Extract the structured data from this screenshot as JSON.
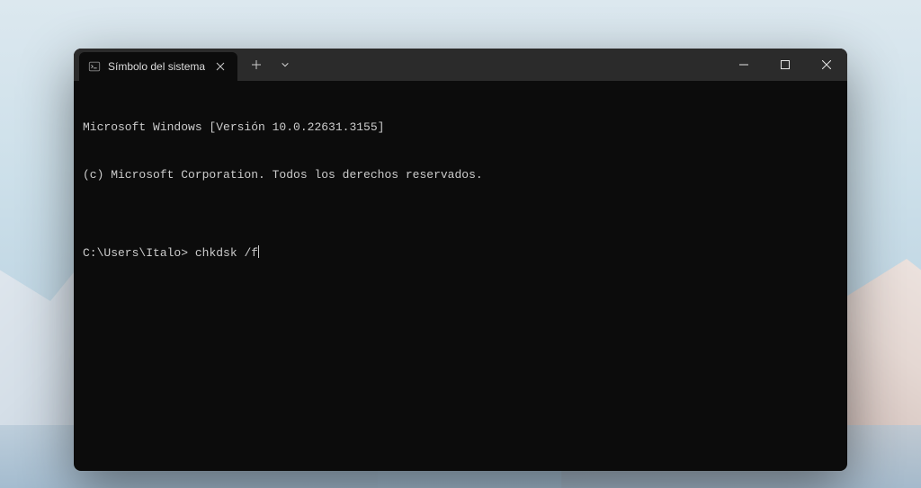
{
  "tab": {
    "title": "Símbolo del sistema"
  },
  "terminal": {
    "line1": "Microsoft Windows [Versión 10.0.22631.3155]",
    "line2": "(c) Microsoft Corporation. Todos los derechos reservados.",
    "blank": "",
    "prompt": "C:\\Users\\Italo>",
    "command": "chkdsk /f"
  }
}
